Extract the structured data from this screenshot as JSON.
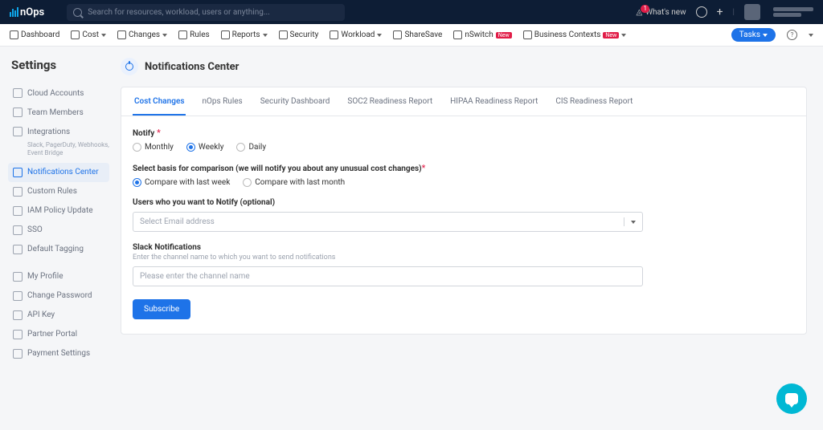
{
  "header": {
    "brand": "nOps",
    "search_placeholder": "Search for resources, workload, users or anything...",
    "badge_count": "1",
    "whats_new": "What's new"
  },
  "menubar": {
    "items": [
      {
        "label": "Dashboard",
        "caret": false
      },
      {
        "label": "Cost",
        "caret": true
      },
      {
        "label": "Changes",
        "caret": true
      },
      {
        "label": "Rules",
        "caret": false
      },
      {
        "label": "Reports",
        "caret": true
      },
      {
        "label": "Security",
        "caret": false
      },
      {
        "label": "Workload",
        "caret": true
      },
      {
        "label": "ShareSave",
        "caret": false
      },
      {
        "label": "nSwitch",
        "badge": "New",
        "caret": false
      },
      {
        "label": "Business Contexts",
        "badge": "New",
        "caret": true
      }
    ],
    "tasks": "Tasks"
  },
  "sidebar": {
    "title": "Settings",
    "groups": [
      [
        {
          "label": "Cloud Accounts"
        },
        {
          "label": "Team Members"
        },
        {
          "label": "Integrations",
          "sub": "Slack, PagerDuty, Webhooks, Event Bridge"
        },
        {
          "label": "Notifications Center",
          "active": true
        },
        {
          "label": "Custom Rules"
        },
        {
          "label": "IAM Policy Update"
        },
        {
          "label": "SSO"
        },
        {
          "label": "Default Tagging"
        }
      ],
      [
        {
          "label": "My Profile"
        },
        {
          "label": "Change Password"
        },
        {
          "label": "API Key"
        },
        {
          "label": "Partner Portal"
        },
        {
          "label": "Payment Settings"
        }
      ]
    ]
  },
  "page": {
    "title": "Notifications Center",
    "tabs": [
      "Cost Changes",
      "nOps Rules",
      "Security Dashboard",
      "SOC2 Readiness Report",
      "HIPAA Readiness Report",
      "CIS Readiness Report"
    ],
    "active_tab": 0,
    "notify_label": "Notify",
    "notify_options": [
      "Monthly",
      "Weekly",
      "Daily"
    ],
    "notify_selected": 1,
    "basis_label": "Select basis for comparison (we will notify you about any unusual cost changes)",
    "basis_options": [
      "Compare with last week",
      "Compare with last month"
    ],
    "basis_selected": 0,
    "users_label": "Users who you want to Notify (optional)",
    "users_placeholder": "Select Email address",
    "slack_label": "Slack Notifications",
    "slack_hint": "Enter the channel name to which you want to send notifications",
    "slack_placeholder": "Please enter the channel name",
    "subscribe": "Subscribe"
  }
}
